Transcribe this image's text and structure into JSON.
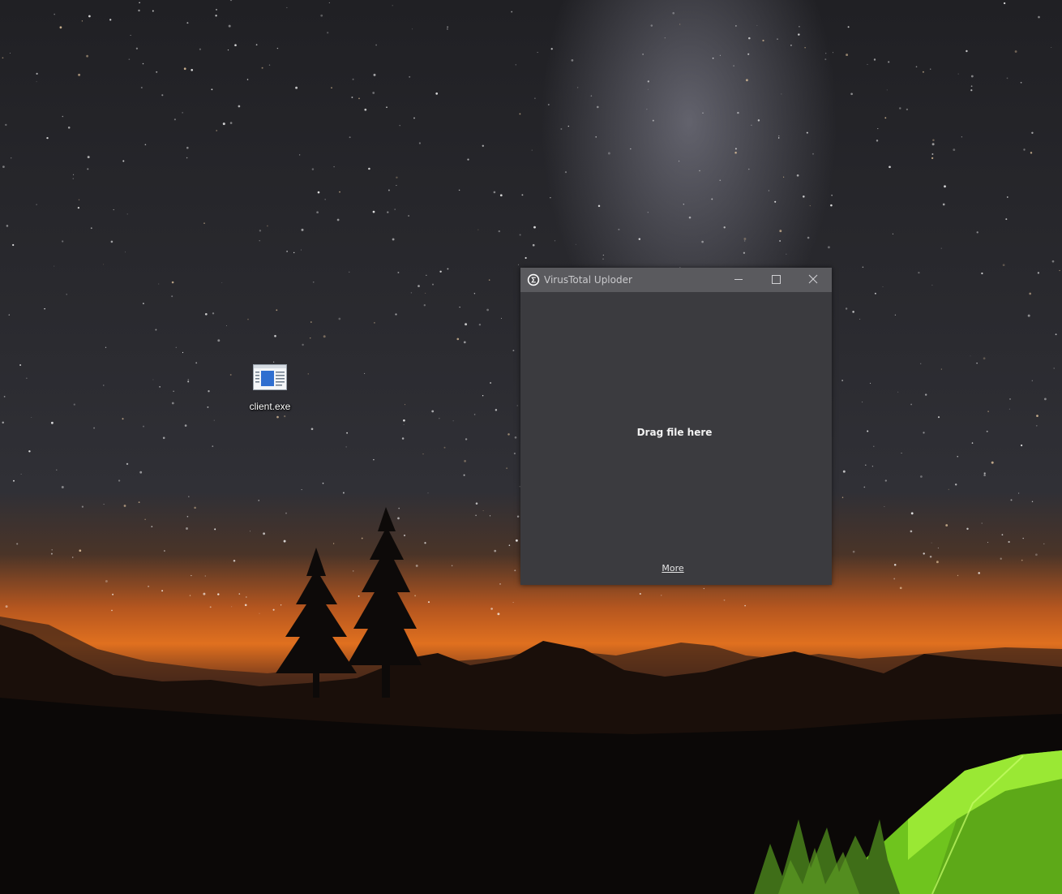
{
  "desktop": {
    "icons": [
      {
        "label": "client.exe",
        "icon": "executable-file-icon"
      }
    ]
  },
  "window": {
    "title": "VirusTotal Uploder",
    "app_icon": "virustotal-sigma-icon",
    "controls": {
      "minimize": "minimize-icon",
      "maximize": "maximize-icon",
      "close": "close-icon"
    },
    "drop_zone_text": "Drag file here",
    "more_link": "More"
  },
  "colors": {
    "window_bg": "#3b3b3f",
    "titlebar_bg": "#5a5a5e",
    "title_text": "#c9c9cc",
    "tent_green": "#8ee32a",
    "horizon_orange": "#e0701f"
  }
}
